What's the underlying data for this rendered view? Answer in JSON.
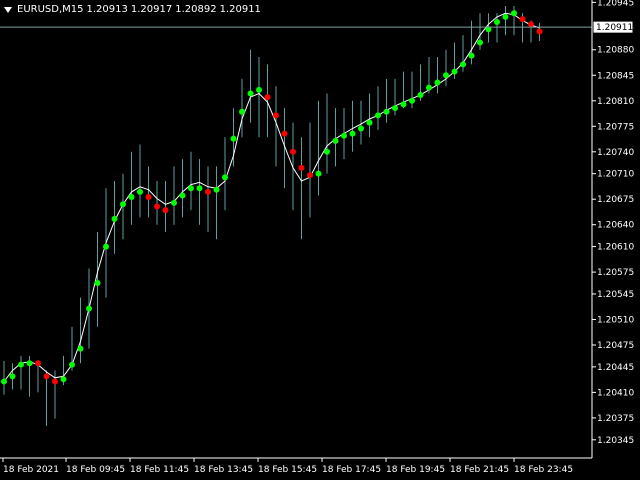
{
  "header": {
    "symbol": "EURUSD,M15",
    "open": "1.20913",
    "high": "1.20917",
    "low": "1.20892",
    "close": "1.20911"
  },
  "price_marker": "1.20911",
  "colors": {
    "background": "#000000",
    "bars": "#5f9ea0",
    "ma_line": "#ffffff",
    "up_dot": "#00ff00",
    "down_dot": "#ff0000",
    "axis": "#ffffff",
    "price_line": "#7f9f9f"
  },
  "chart_data": {
    "type": "line",
    "symbol": "EURUSD",
    "timeframe": "M15",
    "ylim": [
      1.2032,
      1.2094
    ],
    "y_ticks": [
      "1.20945",
      "1.20910",
      "1.20880",
      "1.20845",
      "1.20810",
      "1.20775",
      "1.20740",
      "1.20710",
      "1.20675",
      "1.20640",
      "1.20610",
      "1.20575",
      "1.20545",
      "1.20510",
      "1.20475",
      "1.20445",
      "1.20410",
      "1.20375",
      "1.20345"
    ],
    "x_ticks": [
      "18 Feb 2021",
      "18 Feb 09:45",
      "18 Feb 11:45",
      "18 Feb 13:45",
      "18 Feb 15:45",
      "18 Feb 17:45",
      "18 Feb 19:45",
      "18 Feb 21:45",
      "18 Feb 23:45"
    ],
    "current_price": 1.20911,
    "bars": [
      {
        "h": 1.20453,
        "l": 1.20407
      },
      {
        "h": 1.2045,
        "l": 1.20414
      },
      {
        "h": 1.2046,
        "l": 1.20414
      },
      {
        "h": 1.2046,
        "l": 1.20404
      },
      {
        "h": 1.2045,
        "l": 1.2041
      },
      {
        "h": 1.2044,
        "l": 1.20364
      },
      {
        "h": 1.2044,
        "l": 1.20374
      },
      {
        "h": 1.2046,
        "l": 1.2042
      },
      {
        "h": 1.205,
        "l": 1.2044
      },
      {
        "h": 1.2054,
        "l": 1.2045
      },
      {
        "h": 1.2058,
        "l": 1.2047
      },
      {
        "h": 1.2063,
        "l": 1.205
      },
      {
        "h": 1.2069,
        "l": 1.2054
      },
      {
        "h": 1.207,
        "l": 1.206
      },
      {
        "h": 1.2071,
        "l": 1.2062
      },
      {
        "h": 1.2074,
        "l": 1.2064
      },
      {
        "h": 1.2075,
        "l": 1.2065
      },
      {
        "h": 1.2072,
        "l": 1.2065
      },
      {
        "h": 1.207,
        "l": 1.2064
      },
      {
        "h": 1.207,
        "l": 1.2063
      },
      {
        "h": 1.2072,
        "l": 1.2064
      },
      {
        "h": 1.2073,
        "l": 1.2065
      },
      {
        "h": 1.2074,
        "l": 1.2066
      },
      {
        "h": 1.2073,
        "l": 1.2064
      },
      {
        "h": 1.2072,
        "l": 1.2063
      },
      {
        "h": 1.2072,
        "l": 1.2062
      },
      {
        "h": 1.2076,
        "l": 1.2066
      },
      {
        "h": 1.208,
        "l": 1.2072
      },
      {
        "h": 1.2084,
        "l": 1.2076
      },
      {
        "h": 1.2088,
        "l": 1.2078
      },
      {
        "h": 1.2087,
        "l": 1.2076
      },
      {
        "h": 1.2086,
        "l": 1.2076
      },
      {
        "h": 1.2083,
        "l": 1.2072
      },
      {
        "h": 1.208,
        "l": 1.2069
      },
      {
        "h": 1.2078,
        "l": 1.2066
      },
      {
        "h": 1.2076,
        "l": 1.2062
      },
      {
        "h": 1.2078,
        "l": 1.2065
      },
      {
        "h": 1.2081,
        "l": 1.2068
      },
      {
        "h": 1.2082,
        "l": 1.2071
      },
      {
        "h": 1.208,
        "l": 1.2072
      },
      {
        "h": 1.208,
        "l": 1.2073
      },
      {
        "h": 1.2081,
        "l": 1.2074
      },
      {
        "h": 1.2081,
        "l": 1.2075
      },
      {
        "h": 1.2082,
        "l": 1.2076
      },
      {
        "h": 1.2083,
        "l": 1.2077
      },
      {
        "h": 1.2084,
        "l": 1.2078
      },
      {
        "h": 1.2084,
        "l": 1.2079
      },
      {
        "h": 1.2085,
        "l": 1.208
      },
      {
        "h": 1.2085,
        "l": 1.208
      },
      {
        "h": 1.2086,
        "l": 1.2081
      },
      {
        "h": 1.2087,
        "l": 1.2082
      },
      {
        "h": 1.2087,
        "l": 1.2082
      },
      {
        "h": 1.2088,
        "l": 1.2083
      },
      {
        "h": 1.2089,
        "l": 1.2084
      },
      {
        "h": 1.209,
        "l": 1.2085
      },
      {
        "h": 1.2092,
        "l": 1.2086
      },
      {
        "h": 1.2093,
        "l": 1.2088
      },
      {
        "h": 1.2093,
        "l": 1.2089
      },
      {
        "h": 1.2093,
        "l": 1.2089
      },
      {
        "h": 1.2094,
        "l": 1.209
      },
      {
        "h": 1.2094,
        "l": 1.209
      },
      {
        "h": 1.2093,
        "l": 1.2089
      },
      {
        "h": 1.2092,
        "l": 1.2089
      },
      {
        "h": 1.20917,
        "l": 1.20892
      }
    ],
    "ma": [
      1.20425,
      1.2044,
      1.2045,
      1.20452,
      1.20448,
      1.20438,
      1.2043,
      1.20432,
      1.20448,
      1.2048,
      1.20525,
      1.20575,
      1.20615,
      1.20645,
      1.20668,
      1.20685,
      1.20692,
      1.20688,
      1.20676,
      1.20668,
      1.20672,
      1.20685,
      1.20695,
      1.20698,
      1.20692,
      1.2069,
      1.207,
      1.20735,
      1.20785,
      1.20815,
      1.2082,
      1.20808,
      1.2078,
      1.20748,
      1.20718,
      1.207,
      1.20705,
      1.20728,
      1.20748,
      1.20758,
      1.20765,
      1.20772,
      1.20778,
      1.20785,
      1.2079,
      1.20797,
      1.20803,
      1.20808,
      1.20813,
      1.20818,
      1.20825,
      1.20832,
      1.2084,
      1.2085,
      1.20862,
      1.2088,
      1.209,
      1.20915,
      1.20925,
      1.2093,
      1.20928,
      1.2092,
      1.20914,
      1.2091
    ],
    "dots": [
      {
        "v": 1.20425,
        "c": "up"
      },
      {
        "v": 1.20432,
        "c": "up"
      },
      {
        "v": 1.20448,
        "c": "up"
      },
      {
        "v": 1.2045,
        "c": "up"
      },
      {
        "v": 1.2045,
        "c": "down"
      },
      {
        "v": 1.20432,
        "c": "down"
      },
      {
        "v": 1.20425,
        "c": "down"
      },
      {
        "v": 1.20428,
        "c": "up"
      },
      {
        "v": 1.20448,
        "c": "up"
      },
      {
        "v": 1.2047,
        "c": "up"
      },
      {
        "v": 1.20525,
        "c": "up"
      },
      {
        "v": 1.2056,
        "c": "up"
      },
      {
        "v": 1.2061,
        "c": "up"
      },
      {
        "v": 1.20648,
        "c": "up"
      },
      {
        "v": 1.20668,
        "c": "up"
      },
      {
        "v": 1.20678,
        "c": "up"
      },
      {
        "v": 1.20685,
        "c": "up"
      },
      {
        "v": 1.20678,
        "c": "down"
      },
      {
        "v": 1.20665,
        "c": "down"
      },
      {
        "v": 1.2066,
        "c": "down"
      },
      {
        "v": 1.2067,
        "c": "up"
      },
      {
        "v": 1.2068,
        "c": "up"
      },
      {
        "v": 1.2069,
        "c": "up"
      },
      {
        "v": 1.2069,
        "c": "up"
      },
      {
        "v": 1.20685,
        "c": "down"
      },
      {
        "v": 1.20688,
        "c": "up"
      },
      {
        "v": 1.20705,
        "c": "up"
      },
      {
        "v": 1.20758,
        "c": "up"
      },
      {
        "v": 1.20795,
        "c": "up"
      },
      {
        "v": 1.2082,
        "c": "up"
      },
      {
        "v": 1.20825,
        "c": "up"
      },
      {
        "v": 1.20815,
        "c": "down"
      },
      {
        "v": 1.2079,
        "c": "down"
      },
      {
        "v": 1.20765,
        "c": "down"
      },
      {
        "v": 1.2074,
        "c": "down"
      },
      {
        "v": 1.20718,
        "c": "down"
      },
      {
        "v": 1.20708,
        "c": "down"
      },
      {
        "v": 1.2071,
        "c": "up"
      },
      {
        "v": 1.2074,
        "c": "up"
      },
      {
        "v": 1.20755,
        "c": "up"
      },
      {
        "v": 1.20762,
        "c": "up"
      },
      {
        "v": 1.20765,
        "c": "up"
      },
      {
        "v": 1.20772,
        "c": "up"
      },
      {
        "v": 1.2078,
        "c": "up"
      },
      {
        "v": 1.2079,
        "c": "up"
      },
      {
        "v": 1.20795,
        "c": "up"
      },
      {
        "v": 1.208,
        "c": "up"
      },
      {
        "v": 1.20805,
        "c": "up"
      },
      {
        "v": 1.2081,
        "c": "up"
      },
      {
        "v": 1.20818,
        "c": "up"
      },
      {
        "v": 1.20828,
        "c": "up"
      },
      {
        "v": 1.20835,
        "c": "up"
      },
      {
        "v": 1.20845,
        "c": "up"
      },
      {
        "v": 1.2085,
        "c": "up"
      },
      {
        "v": 1.2086,
        "c": "up"
      },
      {
        "v": 1.20872,
        "c": "up"
      },
      {
        "v": 1.2089,
        "c": "up"
      },
      {
        "v": 1.20908,
        "c": "up"
      },
      {
        "v": 1.20918,
        "c": "up"
      },
      {
        "v": 1.20925,
        "c": "up"
      },
      {
        "v": 1.2093,
        "c": "up"
      },
      {
        "v": 1.20922,
        "c": "down"
      },
      {
        "v": 1.20915,
        "c": "down"
      },
      {
        "v": 1.20905,
        "c": "down"
      }
    ]
  }
}
